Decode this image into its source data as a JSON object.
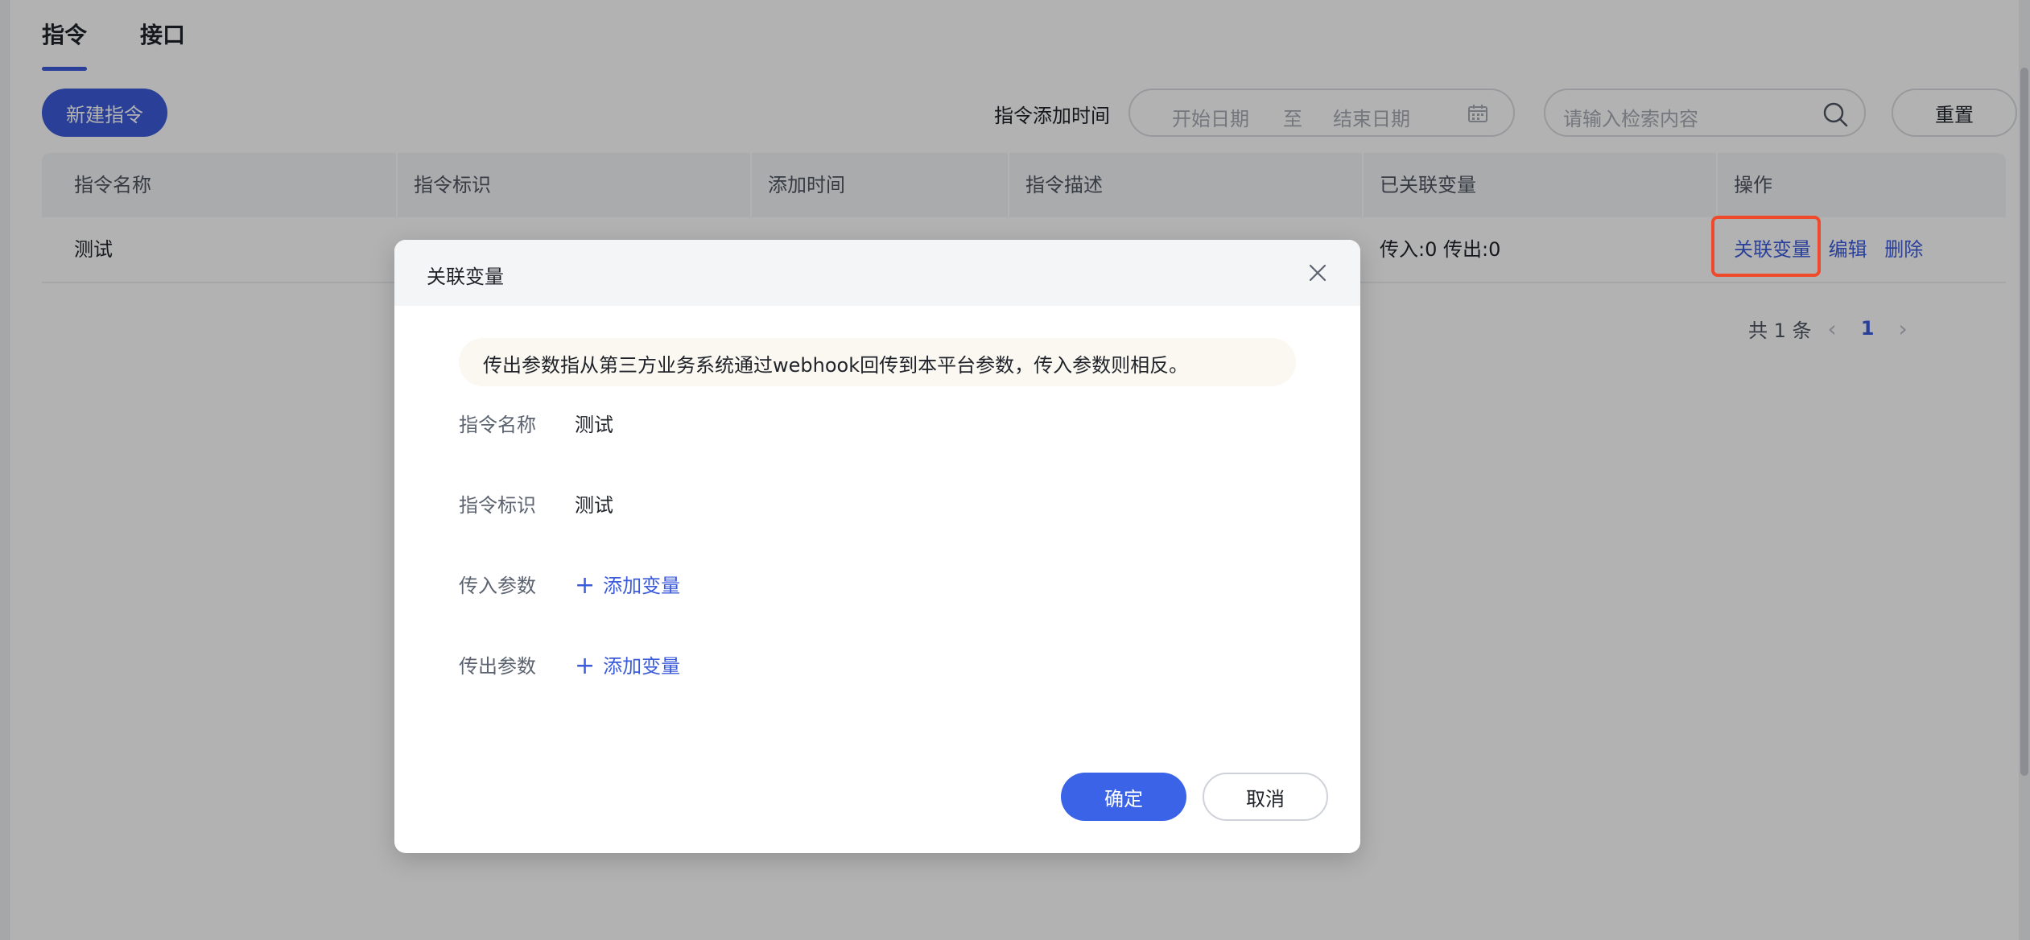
{
  "tabs": [
    {
      "label": "指令",
      "active": true
    },
    {
      "label": "接口",
      "active": false
    }
  ],
  "toolbar": {
    "new_button": "新建指令",
    "date_filter_label": "指令添加时间",
    "date_start_placeholder": "开始日期",
    "date_separator": "至",
    "date_end_placeholder": "结束日期",
    "search_placeholder": "请输入检索内容",
    "reset_button": "重置"
  },
  "table": {
    "headers": [
      "指令名称",
      "指令标识",
      "添加时间",
      "指令描述",
      "已关联变量",
      "操作"
    ],
    "rows": [
      {
        "name": "测试",
        "linked_vars": "传入:0 传出:0",
        "actions": [
          "关联变量",
          "编辑",
          "删除"
        ]
      }
    ]
  },
  "pagination": {
    "total": "共 1 条",
    "current_page": "1"
  },
  "modal": {
    "title": "关联变量",
    "notice": "传出参数指从第三方业务系统通过webhook回传到本平台参数，传入参数则相反。",
    "fields": {
      "name_label": "指令名称",
      "name_value": "测试",
      "id_label": "指令标识",
      "id_value": "测试",
      "in_label": "传入参数",
      "out_label": "传出参数",
      "add_var": "添加变量"
    },
    "ok_button": "确定",
    "cancel_button": "取消"
  },
  "colors": {
    "primary": "#3b5bdb",
    "highlight": "#ef4a2b"
  }
}
